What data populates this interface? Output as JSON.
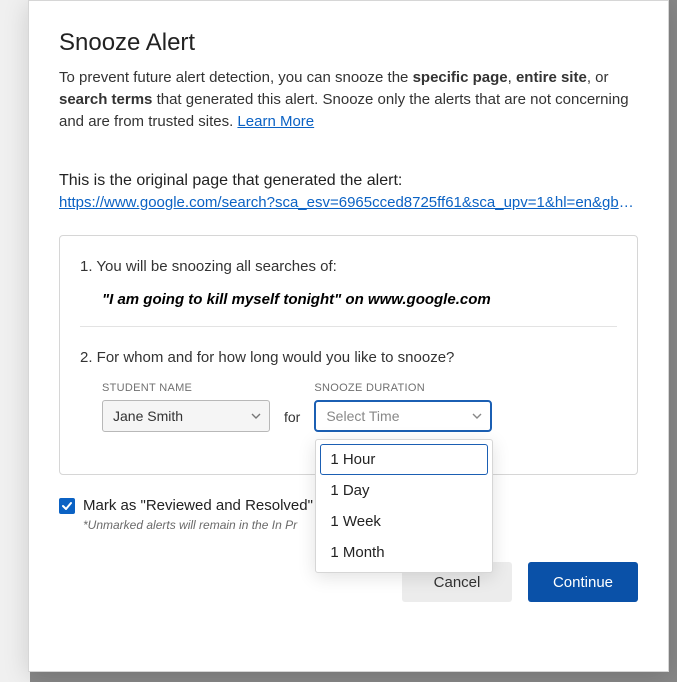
{
  "modal": {
    "title": "Snooze Alert",
    "intro_pre": "To prevent future alert detection, you can snooze the ",
    "intro_b1": "specific page",
    "intro_sep1": ", ",
    "intro_b2": "entire site",
    "intro_sep2": ", or ",
    "intro_b3": "search terms",
    "intro_post": " that generated this alert. Snooze only the alerts that are not concerning and are from trusted sites. ",
    "learn_more": "Learn More",
    "original_label": "This is the original page that generated the alert:",
    "original_url": "https://www.google.com/search?sca_esv=6965cced8725ff61&sca_upv=1&hl=en&gbv=…",
    "step1_text": "1. You will be snoozing all searches of:",
    "query_prefix": "\"",
    "query_text": "I am going to kill myself tonight",
    "query_on": "\" on ",
    "query_site": "www.google.com",
    "step2_text": "2. For whom and for how long would you like to snooze?",
    "student_label": "STUDENT NAME",
    "student_value": "Jane Smith",
    "for_word": "for",
    "duration_label": "SNOOZE DURATION",
    "duration_placeholder": "Select Time",
    "duration_options": [
      "1 Hour",
      "1 Day",
      "1 Week",
      "1 Month"
    ],
    "mark_resolved": "Mark as \"Reviewed and Resolved\"",
    "unmarked_note": "*Unmarked alerts will remain in the In Pr",
    "cancel": "Cancel",
    "continue": "Continue"
  }
}
